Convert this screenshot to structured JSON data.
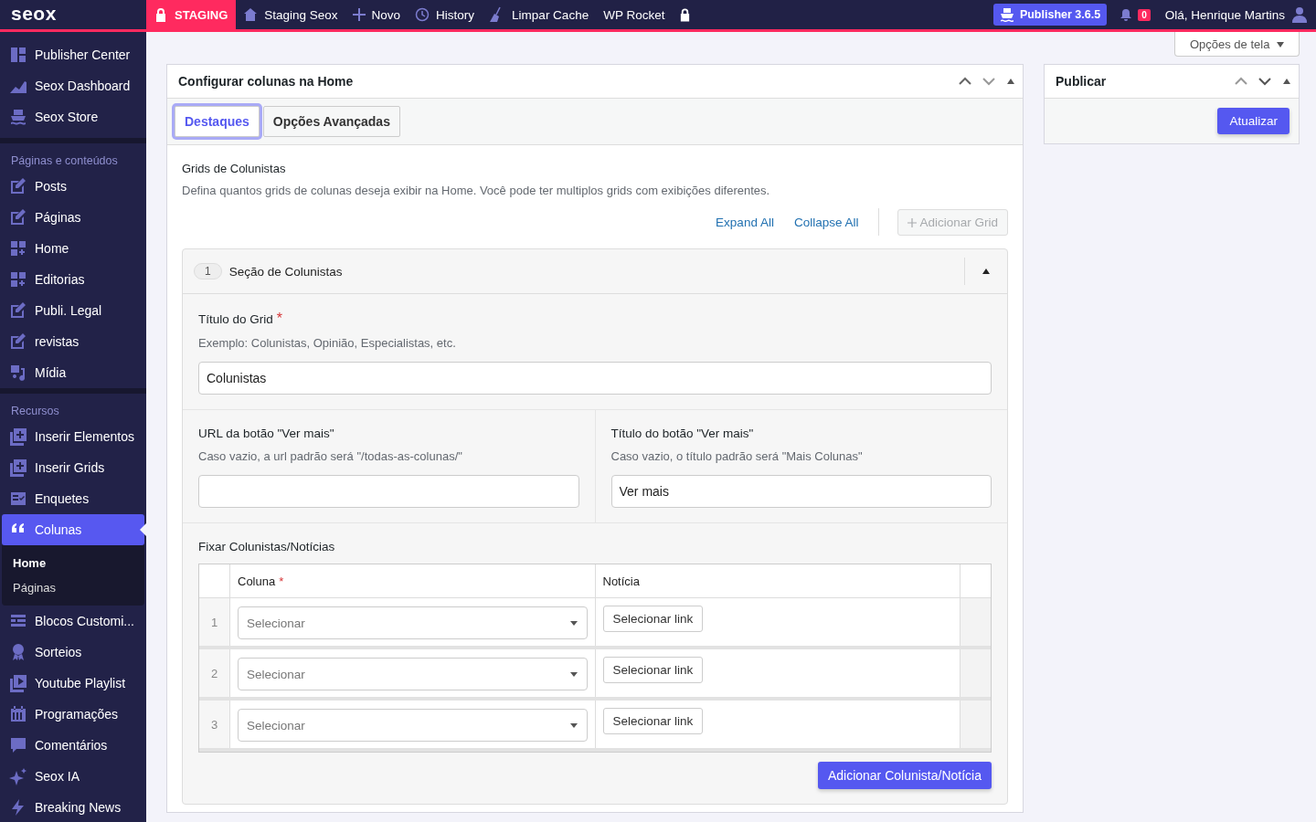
{
  "topbar": {
    "logo": "seox",
    "staging": "STAGING",
    "items": [
      {
        "label": "Staging Seox"
      },
      {
        "label": "Novo"
      },
      {
        "label": "History"
      },
      {
        "label": "Limpar Cache"
      },
      {
        "label": "WP Rocket"
      }
    ],
    "publisher": "Publisher 3.6.5",
    "notifications": "0",
    "greeting": "Olá, Henrique Martins"
  },
  "sidebar": {
    "sections": [
      {
        "items": [
          {
            "label": "Publisher Center",
            "selected": false
          },
          {
            "label": "Seox Dashboard",
            "selected": false
          },
          {
            "label": "Seox Store",
            "selected": false
          }
        ]
      },
      {
        "heading": "Páginas e conteúdos",
        "items": [
          {
            "label": "Posts",
            "selected": false
          },
          {
            "label": "Páginas",
            "selected": false
          },
          {
            "label": "Home",
            "selected": false
          },
          {
            "label": "Editorias",
            "selected": false
          },
          {
            "label": "Publi. Legal",
            "selected": false
          },
          {
            "label": "revistas",
            "selected": false
          },
          {
            "label": "Mídia",
            "selected": false
          }
        ]
      },
      {
        "heading": "Recursos",
        "items": [
          {
            "label": "Inserir Elementos",
            "selected": false
          },
          {
            "label": "Inserir Grids",
            "selected": false
          },
          {
            "label": "Enquetes",
            "selected": false
          },
          {
            "label": "Colunas",
            "selected": true,
            "children": [
              {
                "label": "Home",
                "selected": true
              },
              {
                "label": "Páginas",
                "selected": false
              }
            ]
          },
          {
            "label": "Blocos Customi...",
            "selected": false
          },
          {
            "label": "Sorteios",
            "selected": false
          },
          {
            "label": "Youtube Playlist",
            "selected": false
          },
          {
            "label": "Programações",
            "selected": false
          },
          {
            "label": "Comentários",
            "selected": false
          },
          {
            "label": "Seox IA",
            "selected": false
          },
          {
            "label": "Breaking News",
            "selected": false
          }
        ]
      }
    ]
  },
  "screen_options": "Opções de tela",
  "required_mark": "*",
  "main_panel": {
    "title": "Configurar colunas na Home",
    "tabs": [
      {
        "label": "Destaques",
        "selected": true
      },
      {
        "label": "Opções Avançadas",
        "selected": false
      }
    ],
    "section_title": "Grids de Colunistas",
    "section_description": "Defina quantos grids de colunas deseja exibir na Home. Você pode ter multiplos grids com exibições diferentes.",
    "expand_all": "Expand All",
    "collapse_all": "Collapse All",
    "add_grid": {
      "label": "Adicionar Grid",
      "disabled": true
    },
    "grid": {
      "number": "1",
      "title": "Seção de Colunistas",
      "expanded": true,
      "title_field": {
        "label": "Título do Grid",
        "required": true,
        "hint": "Exemplo: Colunistas, Opinião, Especialistas, etc.",
        "value": "Colunistas"
      },
      "url_field": {
        "label": "URL da botão \"Ver mais\"",
        "hint": "Caso vazio, a url padrão será \"/todas-as-colunas/\""
      },
      "button_title_field": {
        "label": "Título do botão \"Ver mais\"",
        "hint": "Caso vazio, o título padrão será \"Mais Colunas\"",
        "value": "Ver mais"
      },
      "pinned": {
        "label": "Fixar Colunistas/Notícias",
        "columns": [
          {
            "label": "Coluna",
            "required": true
          },
          {
            "label": "Notícia",
            "required": false
          }
        ],
        "rows": [
          {
            "number": "1",
            "select": "Selecionar",
            "link_button": "Selecionar link"
          },
          {
            "number": "2",
            "select": "Selecionar",
            "link_button": "Selecionar link"
          },
          {
            "number": "3",
            "select": "Selecionar",
            "link_button": "Selecionar link"
          }
        ],
        "add_button": "Adicionar Colunista/Notícia"
      }
    }
  },
  "publish_panel": {
    "title": "Publicar",
    "button": "Atualizar"
  }
}
